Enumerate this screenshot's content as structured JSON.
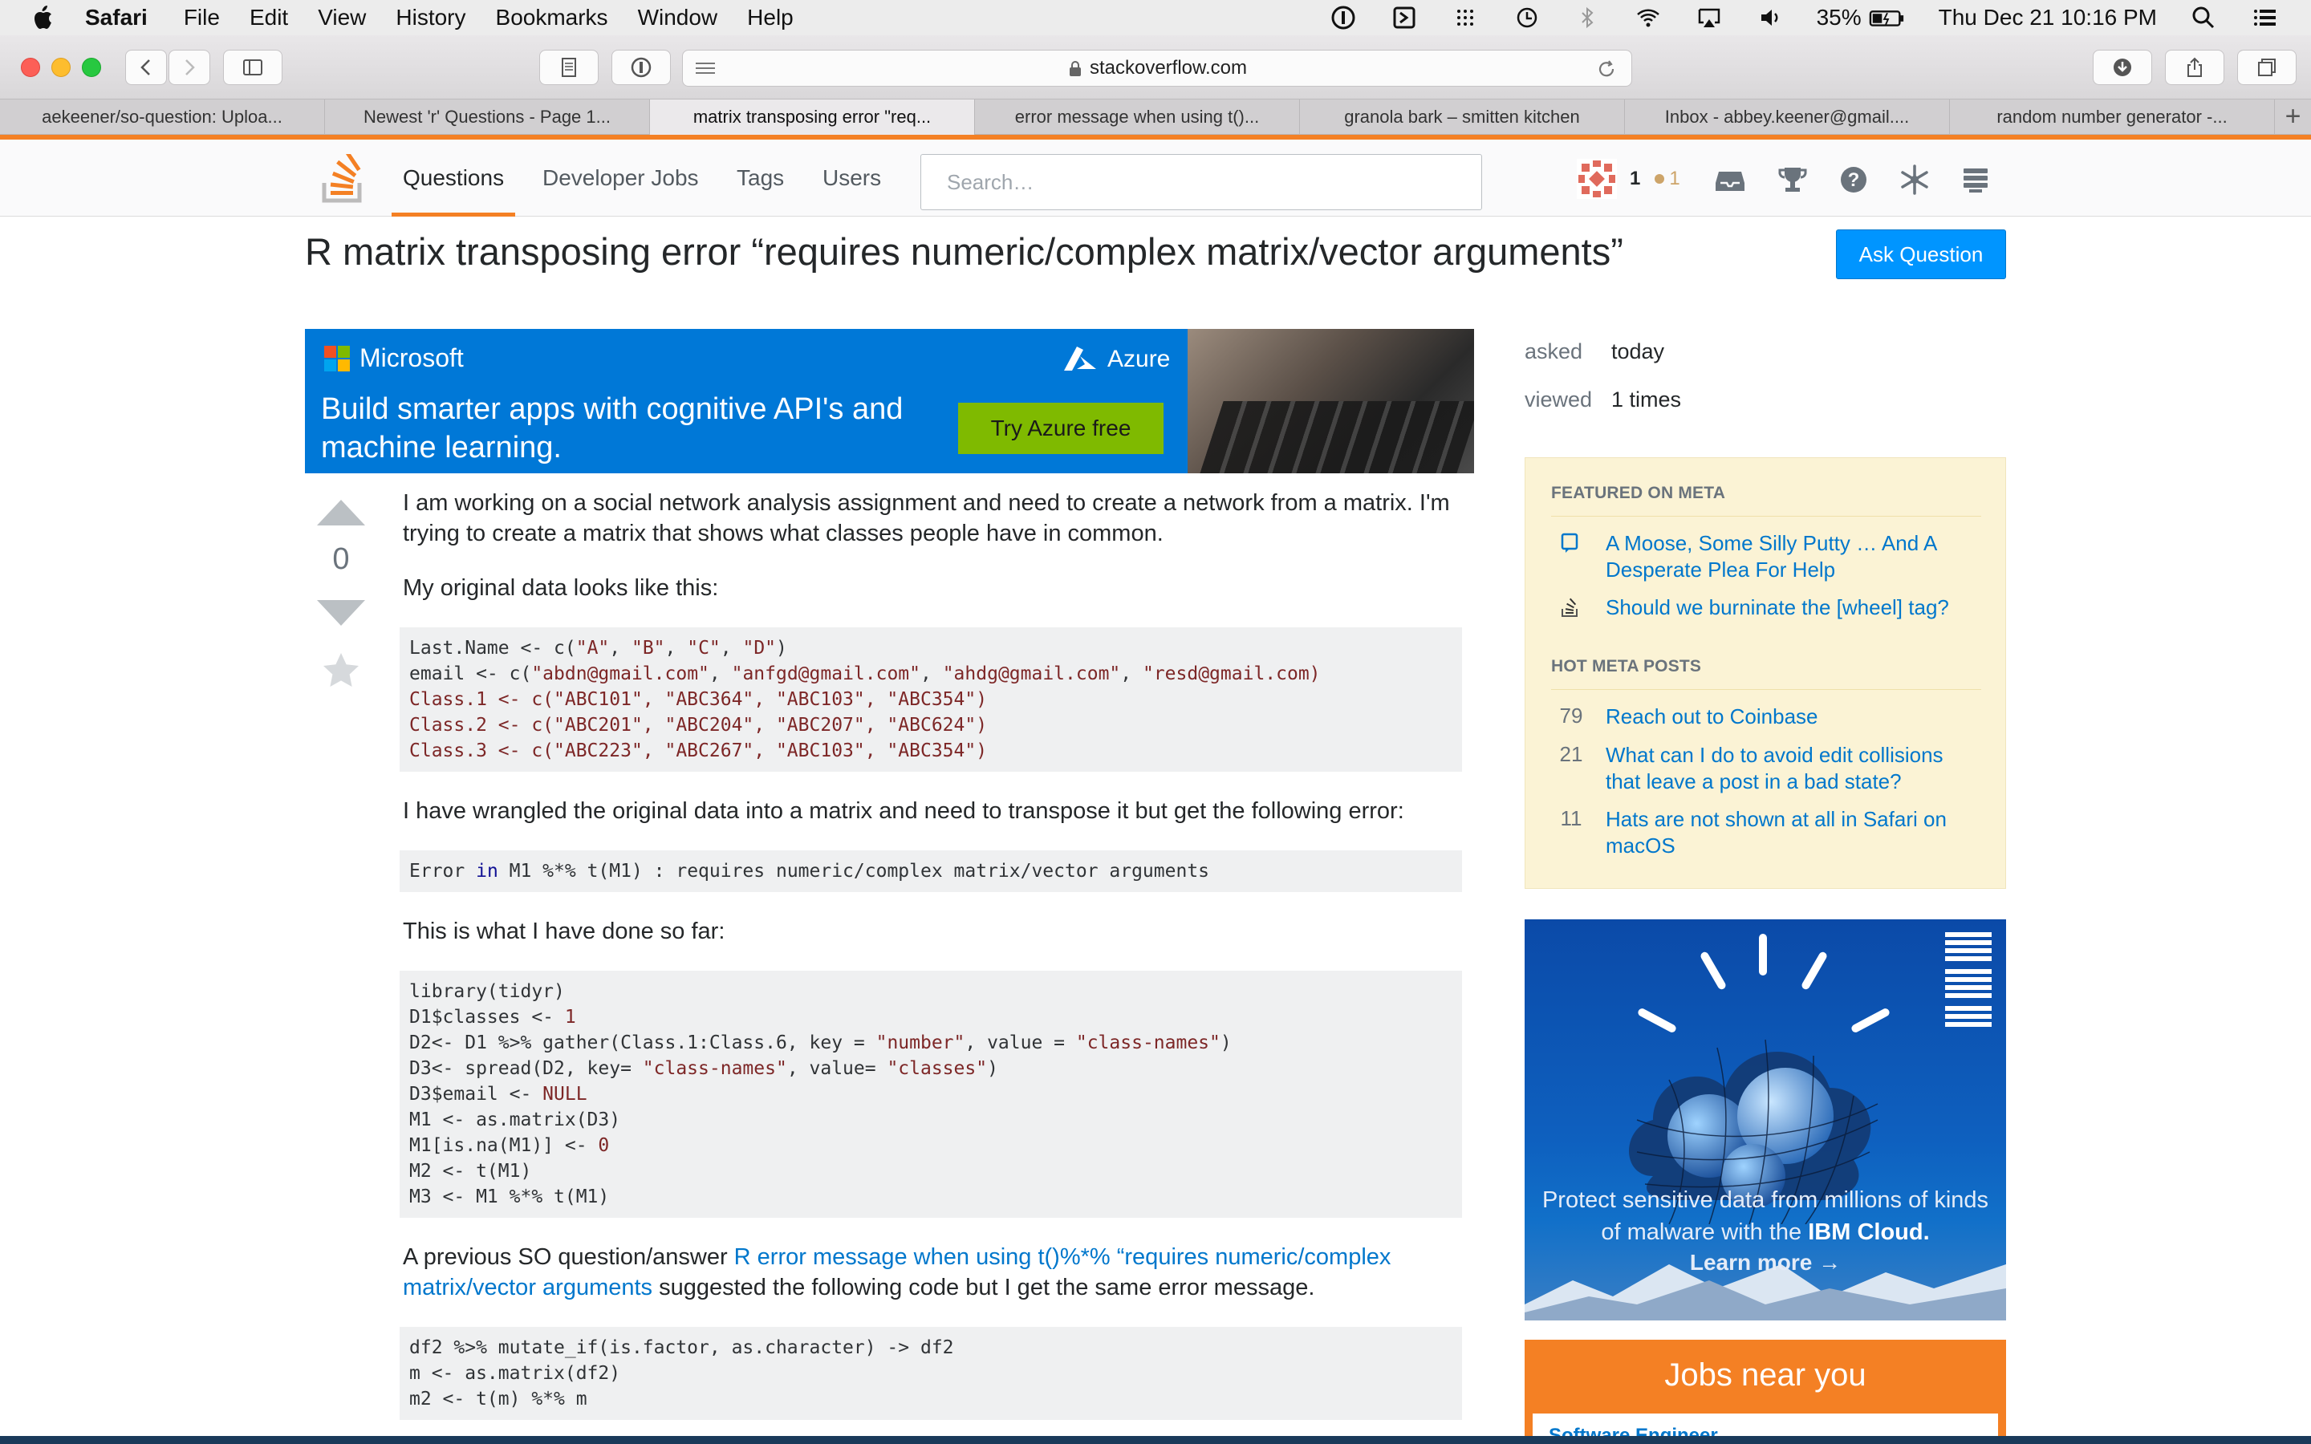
{
  "menubar": {
    "app": "Safari",
    "items": [
      "File",
      "Edit",
      "View",
      "History",
      "Bookmarks",
      "Window",
      "Help"
    ],
    "battery": "35%",
    "clock": "Thu Dec 21  10:16 PM"
  },
  "browser": {
    "url": "stackoverflow.com",
    "tabs": [
      "aekeener/so-question: Uploa...",
      "Newest 'r' Questions - Page 1...",
      "matrix transposing error \"req...",
      "error message when using t()...",
      "granola bark – smitten kitchen",
      "Inbox - abbey.keener@gmail....",
      "random number generator -..."
    ],
    "active_tab": 2
  },
  "so": {
    "nav": [
      "Questions",
      "Developer Jobs",
      "Tags",
      "Users"
    ],
    "search_placeholder": "Search…",
    "rep": "1",
    "badges": "1"
  },
  "question": {
    "title": "R matrix transposing error “requires numeric/complex matrix/vector arguments”",
    "ask_button": "Ask Question",
    "votes": "0",
    "p1": "I am working on a social network analysis assignment and need to create a network from a matrix. I'm trying to create a matrix that shows what classes people have in common.",
    "p2": "My original data looks like this:",
    "p3": "I have wrangled the original data into a matrix and need to transpose it but get the following error:",
    "p4": "This is what I have done so far:",
    "p5_before": "A previous SO question/answer ",
    "p5_link": "R error message when using t()%*% “requires numeric/complex matrix/vector arguments",
    "p5_after": " suggested the following code but I get the same error message."
  },
  "ad_ms": {
    "brand": "Microsoft",
    "product": "Azure",
    "tagline": "Build smarter apps with cognitive API's and machine learning.",
    "cta": "Try Azure free"
  },
  "sidebar": {
    "asked_label": "asked",
    "asked_value": "today",
    "viewed_label": "viewed",
    "viewed_value": "1 times",
    "featured_header": "FEATURED ON META",
    "featured": [
      "A Moose, Some Silly Putty … And A Desperate Plea For Help",
      "Should we burninate the [wheel] tag?"
    ],
    "hot_header": "HOT META POSTS",
    "hot": [
      {
        "score": "79",
        "title": "Reach out to Coinbase"
      },
      {
        "score": "21",
        "title": "What can I do to avoid edit collisions that leave a post in a bad state?"
      },
      {
        "score": "11",
        "title": "Hats are not shown at all in Safari on macOS"
      }
    ],
    "ibm_copy_1": "Protect sensitive data from millions of kinds of malware with the ",
    "ibm_copy_bold": "IBM Cloud.",
    "ibm_more": "Learn more →",
    "jobs_title": "Jobs near you",
    "jobs_first": "Software Engineer"
  },
  "colors": {
    "so_orange": "#f48024",
    "link_blue": "#0077cc",
    "ask_button": "#0095ff",
    "meta_bg": "#fbf3d5",
    "azure_blue": "#0078d7",
    "azure_green": "#7fba00"
  }
}
